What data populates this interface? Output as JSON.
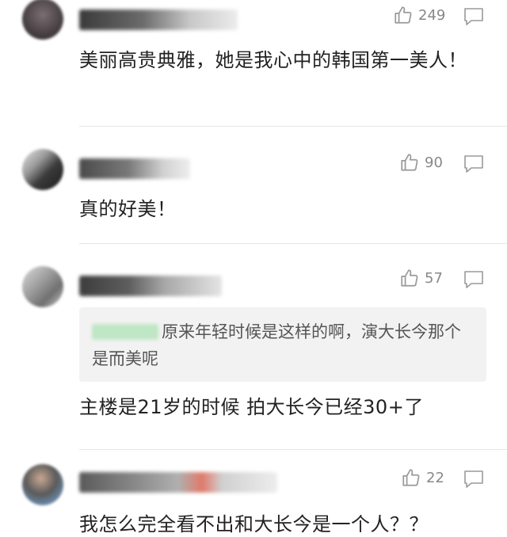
{
  "comments": [
    {
      "likes": "249",
      "text": "美丽高贵典雅，她是我心中的韩国第一美人！"
    },
    {
      "likes": "90",
      "text": "真的好美！"
    },
    {
      "likes": "57",
      "quote": "原来年轻时候是这样的啊，演大长今那个是而美呢",
      "text": "主楼是21岁的时候 拍大长今已经30+了"
    },
    {
      "likes": "22",
      "text": "我怎么完全看不出和大长今是一个人？？"
    }
  ],
  "colors": {
    "icon": "#9a9a9a",
    "text": "#222222",
    "quote_bg": "#f2f2f2"
  },
  "icons": [
    "thumbs-up-icon",
    "reply-bubble-icon"
  ]
}
